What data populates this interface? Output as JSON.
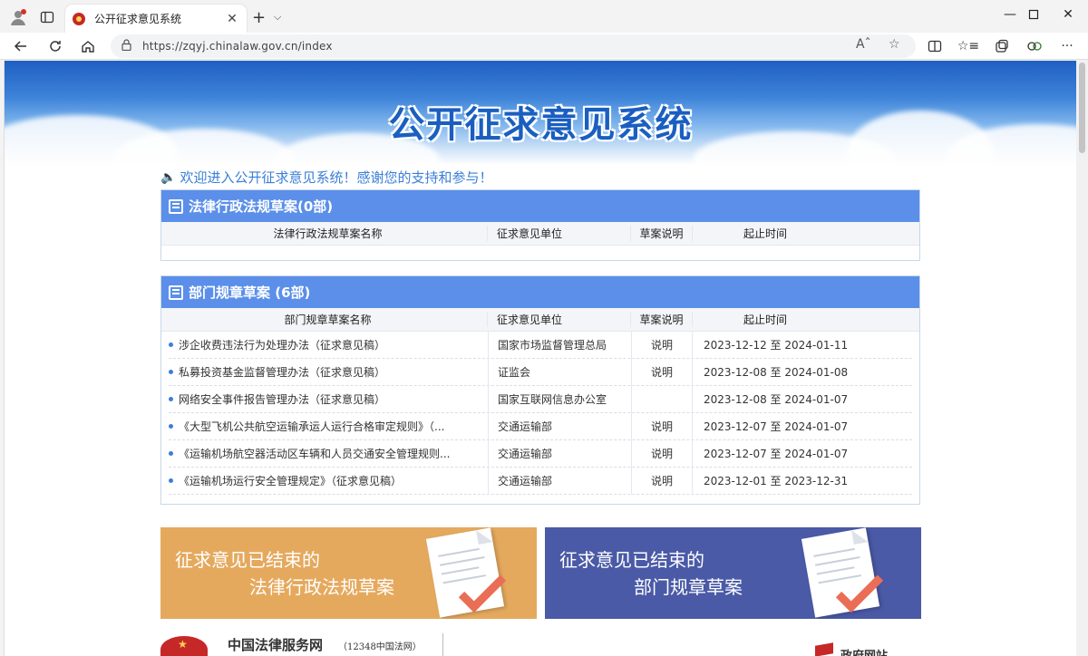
{
  "browser": {
    "tab_title": "公开征求意见系统",
    "url": "https://zqyj.chinalaw.gov.cn/index",
    "icons": [
      "profile-icon",
      "tab-actions-icon",
      "favicon",
      "close-icon",
      "new-tab-icon",
      "tab-menu-icon",
      "minimize-icon",
      "maximize-icon",
      "window-close-icon",
      "back-icon",
      "refresh-icon",
      "home-icon",
      "lock-icon",
      "read-aloud-icon",
      "favorite-icon",
      "split-screen-icon",
      "favorites-icon",
      "collections-icon",
      "extensions-icon",
      "more-icon"
    ]
  },
  "page": {
    "banner_title": "公开征求意见系统",
    "welcome": "欢迎进入公开征求意见系统！感谢您的支持和参与！",
    "laws": {
      "title": "法律行政法规草案(0部)",
      "columns": [
        "法律行政法规草案名称",
        "征求意见单位",
        "草案说明",
        "起止时间"
      ],
      "rows": []
    },
    "rules": {
      "title": "部门规章草案 (6部)",
      "columns": [
        "部门规章草案名称",
        "征求意见单位",
        "草案说明",
        "起止时间"
      ],
      "rows": [
        {
          "name": "涉企收费违法行为处理办法（征求意见稿）",
          "unit": "国家市场监督管理总局",
          "note": "说明",
          "period": "2023-12-12 至 2024-01-11"
        },
        {
          "name": "私募投资基金监督管理办法（征求意见稿）",
          "unit": "证监会",
          "note": "说明",
          "period": "2023-12-08 至 2024-01-08"
        },
        {
          "name": "网络安全事件报告管理办法（征求意见稿）",
          "unit": "国家互联网信息办公室",
          "note": "",
          "period": "2023-12-08 至 2024-01-07"
        },
        {
          "name": "《大型飞机公共航空运输承运人运行合格审定规则》（...",
          "unit": "交通运输部",
          "note": "说明",
          "period": "2023-12-07 至 2024-01-07"
        },
        {
          "name": "《运输机场航空器活动区车辆和人员交通安全管理规则...",
          "unit": "交通运输部",
          "note": "说明",
          "period": "2023-12-07 至 2024-01-07"
        },
        {
          "name": "《运输机场运行安全管理规定》（征求意见稿）",
          "unit": "交通运输部",
          "note": "说明",
          "period": "2023-12-01 至 2023-12-31"
        }
      ]
    },
    "promo_laws": {
      "line1": "征求意见已结束的",
      "line2": "法律行政法规草案",
      "color": "#e5a95e"
    },
    "promo_rules": {
      "line1": "征求意见已结束的",
      "line2": "部门规章草案",
      "color": "#4a5aa6"
    },
    "footer": {
      "title": "中国法律服务网",
      "subtitle": "（12348中国法网）",
      "right_text": "政府网站"
    }
  }
}
